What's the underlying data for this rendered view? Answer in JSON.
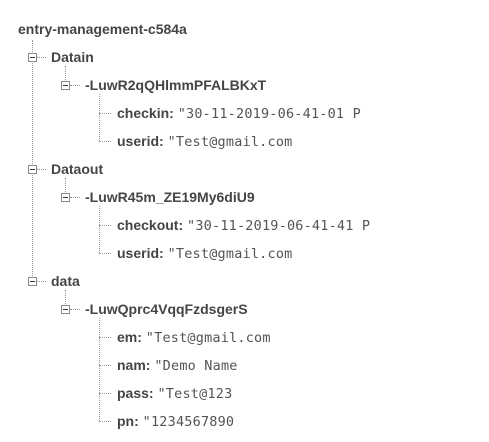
{
  "root": {
    "label": "entry-management-c584a"
  },
  "nodes": [
    {
      "name": "Datain",
      "child": {
        "name": "-LuwR2qQHlmmPFALBKxT",
        "fields": [
          {
            "key": "checkin:",
            "value": "\"30-11-2019-06-41-01 P"
          },
          {
            "key": "userid:",
            "value": "\"Test@gmail.com"
          }
        ]
      }
    },
    {
      "name": "Dataout",
      "child": {
        "name": "-LuwR45m_ZE19My6diU9",
        "fields": [
          {
            "key": "checkout:",
            "value": "\"30-11-2019-06-41-41 P"
          },
          {
            "key": "userid:",
            "value": "\"Test@gmail.com"
          }
        ]
      }
    },
    {
      "name": "data",
      "child": {
        "name": "-LuwQprc4VqqFzdsgerS",
        "fields": [
          {
            "key": "em:",
            "value": "\"Test@gmail.com"
          },
          {
            "key": "nam:",
            "value": "\"Demo Name"
          },
          {
            "key": "pass:",
            "value": "\"Test@123"
          },
          {
            "key": "pn:",
            "value": "\"1234567890"
          }
        ]
      }
    }
  ]
}
